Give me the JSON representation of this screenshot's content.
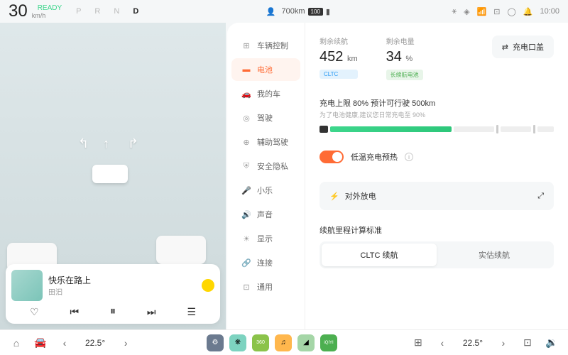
{
  "top": {
    "speed": "30",
    "speedUnit": "km/h",
    "ready": "READY",
    "gears": [
      "P",
      "R",
      "N",
      "D"
    ],
    "activeGear": "D",
    "range": "700km",
    "battery": "100",
    "time": "10:00"
  },
  "music": {
    "title": "快乐在路上",
    "artist": "田汩"
  },
  "sidebar": {
    "items": [
      {
        "label": "车辆控制"
      },
      {
        "label": "电池"
      },
      {
        "label": "我的车"
      },
      {
        "label": "驾驶"
      },
      {
        "label": "辅助驾驶"
      },
      {
        "label": "安全隐私"
      },
      {
        "label": "小乐"
      },
      {
        "label": "声音"
      },
      {
        "label": "显示"
      },
      {
        "label": "连接"
      },
      {
        "label": "通用"
      }
    ]
  },
  "battery": {
    "rangeLabel": "剩余续航",
    "rangeVal": "452",
    "rangeUnit": "km",
    "rangeBadge": "CLTC",
    "socLabel": "剩余电量",
    "socVal": "34",
    "socUnit": "%",
    "socBadge": "长续航电池",
    "portBtn": "充电口盖",
    "chargeLimitTitle": "充电上限 80%    预计可行驶 500km",
    "chargeLimitSub": "为了电池健康,建议您日常充电至 90%",
    "preheatLabel": "低温充电预热",
    "dischargeLabel": "对外放电",
    "rangeStdLabel": "续航里程计算标准",
    "seg1": "CLTC 续航",
    "seg2": "实估续航"
  },
  "bottom": {
    "tempL": "22.5°",
    "tempR": "22.5°"
  }
}
